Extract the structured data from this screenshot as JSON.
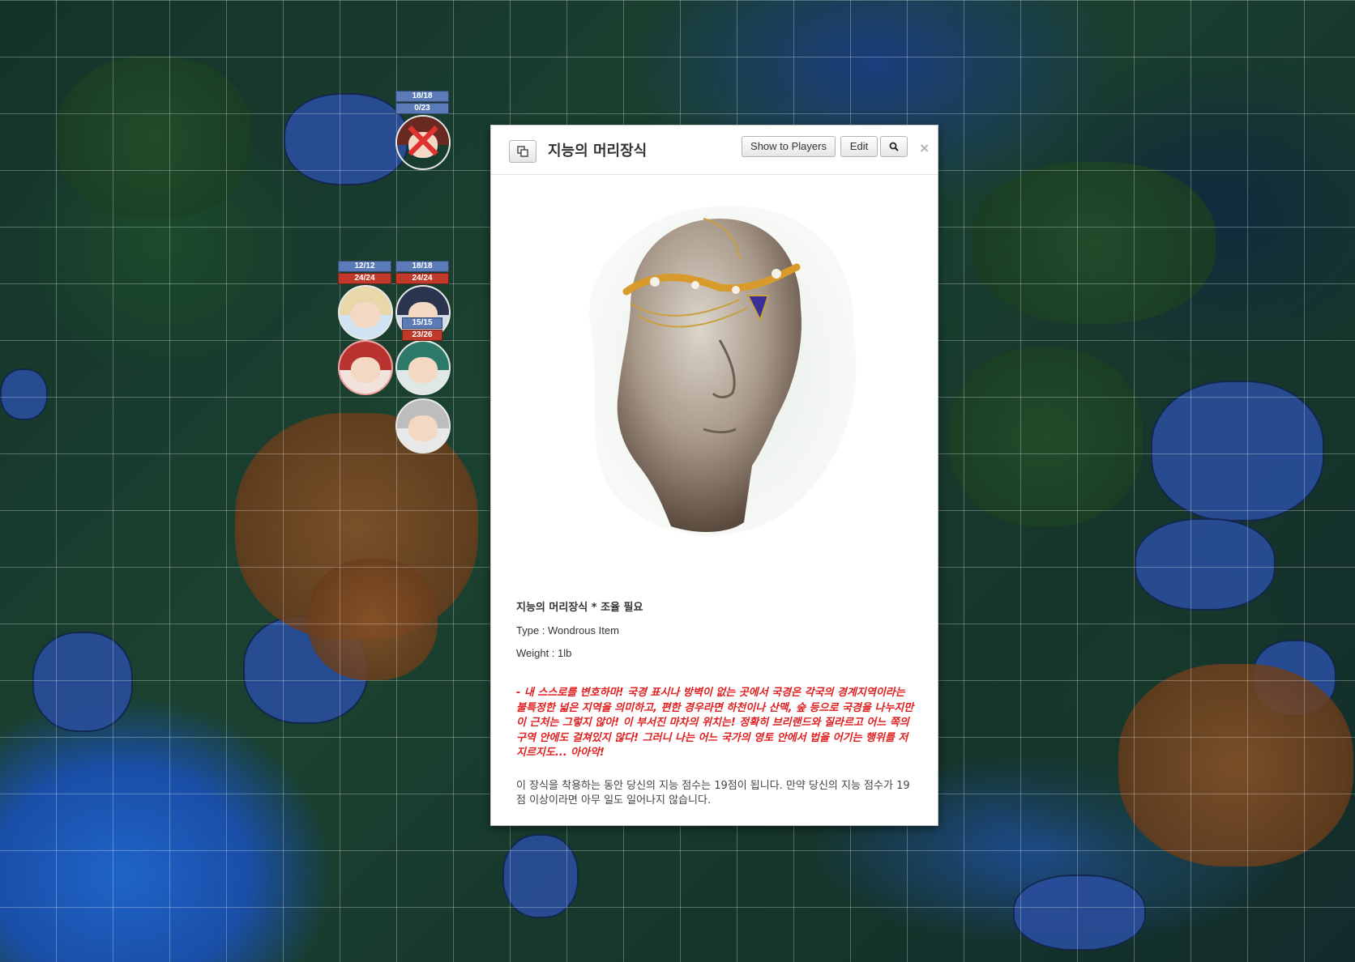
{
  "tokens": [
    {
      "id": "defeated-token",
      "bars": [
        "18/18",
        "0/23"
      ],
      "bar_colors": [
        "blue",
        "blue"
      ],
      "defeated": true,
      "hair": "#6a2a22"
    },
    {
      "id": "blonde-token",
      "bars": [
        "12/12",
        "24/24"
      ],
      "bar_colors": [
        "blue",
        "red"
      ],
      "hair": "#e8d7a8"
    },
    {
      "id": "dark-hair-token",
      "bars": [
        "18/18",
        "24/24"
      ],
      "bar_colors": [
        "blue",
        "red"
      ],
      "hair": "#2c3550"
    },
    {
      "id": "red-hood-token",
      "bars": [],
      "hair": "#b8332f"
    },
    {
      "id": "green-hair-token",
      "bars": [
        "15/15",
        "23/26"
      ],
      "bar_colors": [
        "blue",
        "red"
      ],
      "hair": "#2e7a6a"
    },
    {
      "id": "silver-hair-token",
      "bars": [],
      "hair": "#bdbdbd"
    }
  ],
  "dialog": {
    "title": "지능의 머리장식",
    "show_label": "Show to Players",
    "edit_label": "Edit",
    "close_glyph": "×",
    "item_name": "지능의 머리장식 * 조율 필요",
    "type_line": "Type : Wondrous Item",
    "weight_line": "Weight : 1lb",
    "flavor_text": "- 내 스스로를 변호하마! 국경 표시나 방벽이 없는 곳에서 국경은 각국의 경계지역이라는 불특정한 넓은 지역을 의미하고, 편한 경우라면 하천이나 산맥, 숲 등으로 국경을 나누지만 이 근처는 그렇지 않아! 이 부서진 마차의 위치는! 정확히 브리랜드와 질라르고 어느 쪽의 구역 안에도 걸쳐있지 않다! 그러니 나는 어느 국가의 영토 안에서 법을 어기는 행위를 저지르지도... 아아악!",
    "rule_text": "이 장식을 착용하는 동안 당신의 지능 점수는 19점이 됩니다. 만약 당신의 지능 점수가 19점 이상이라면 아무 일도 일어나지 않습니다."
  }
}
